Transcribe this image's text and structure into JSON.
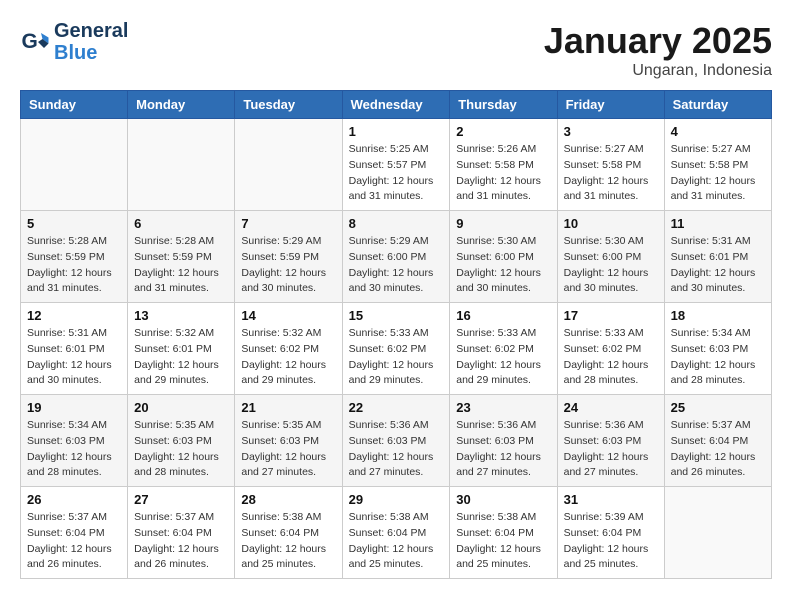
{
  "logo": {
    "line1": "General",
    "line2": "Blue"
  },
  "title": "January 2025",
  "subtitle": "Ungaran, Indonesia",
  "days_header": [
    "Sunday",
    "Monday",
    "Tuesday",
    "Wednesday",
    "Thursday",
    "Friday",
    "Saturday"
  ],
  "weeks": [
    [
      {
        "day": "",
        "info": ""
      },
      {
        "day": "",
        "info": ""
      },
      {
        "day": "",
        "info": ""
      },
      {
        "day": "1",
        "info": "Sunrise: 5:25 AM\nSunset: 5:57 PM\nDaylight: 12 hours\nand 31 minutes."
      },
      {
        "day": "2",
        "info": "Sunrise: 5:26 AM\nSunset: 5:58 PM\nDaylight: 12 hours\nand 31 minutes."
      },
      {
        "day": "3",
        "info": "Sunrise: 5:27 AM\nSunset: 5:58 PM\nDaylight: 12 hours\nand 31 minutes."
      },
      {
        "day": "4",
        "info": "Sunrise: 5:27 AM\nSunset: 5:58 PM\nDaylight: 12 hours\nand 31 minutes."
      }
    ],
    [
      {
        "day": "5",
        "info": "Sunrise: 5:28 AM\nSunset: 5:59 PM\nDaylight: 12 hours\nand 31 minutes."
      },
      {
        "day": "6",
        "info": "Sunrise: 5:28 AM\nSunset: 5:59 PM\nDaylight: 12 hours\nand 31 minutes."
      },
      {
        "day": "7",
        "info": "Sunrise: 5:29 AM\nSunset: 5:59 PM\nDaylight: 12 hours\nand 30 minutes."
      },
      {
        "day": "8",
        "info": "Sunrise: 5:29 AM\nSunset: 6:00 PM\nDaylight: 12 hours\nand 30 minutes."
      },
      {
        "day": "9",
        "info": "Sunrise: 5:30 AM\nSunset: 6:00 PM\nDaylight: 12 hours\nand 30 minutes."
      },
      {
        "day": "10",
        "info": "Sunrise: 5:30 AM\nSunset: 6:00 PM\nDaylight: 12 hours\nand 30 minutes."
      },
      {
        "day": "11",
        "info": "Sunrise: 5:31 AM\nSunset: 6:01 PM\nDaylight: 12 hours\nand 30 minutes."
      }
    ],
    [
      {
        "day": "12",
        "info": "Sunrise: 5:31 AM\nSunset: 6:01 PM\nDaylight: 12 hours\nand 30 minutes."
      },
      {
        "day": "13",
        "info": "Sunrise: 5:32 AM\nSunset: 6:01 PM\nDaylight: 12 hours\nand 29 minutes."
      },
      {
        "day": "14",
        "info": "Sunrise: 5:32 AM\nSunset: 6:02 PM\nDaylight: 12 hours\nand 29 minutes."
      },
      {
        "day": "15",
        "info": "Sunrise: 5:33 AM\nSunset: 6:02 PM\nDaylight: 12 hours\nand 29 minutes."
      },
      {
        "day": "16",
        "info": "Sunrise: 5:33 AM\nSunset: 6:02 PM\nDaylight: 12 hours\nand 29 minutes."
      },
      {
        "day": "17",
        "info": "Sunrise: 5:33 AM\nSunset: 6:02 PM\nDaylight: 12 hours\nand 28 minutes."
      },
      {
        "day": "18",
        "info": "Sunrise: 5:34 AM\nSunset: 6:03 PM\nDaylight: 12 hours\nand 28 minutes."
      }
    ],
    [
      {
        "day": "19",
        "info": "Sunrise: 5:34 AM\nSunset: 6:03 PM\nDaylight: 12 hours\nand 28 minutes."
      },
      {
        "day": "20",
        "info": "Sunrise: 5:35 AM\nSunset: 6:03 PM\nDaylight: 12 hours\nand 28 minutes."
      },
      {
        "day": "21",
        "info": "Sunrise: 5:35 AM\nSunset: 6:03 PM\nDaylight: 12 hours\nand 27 minutes."
      },
      {
        "day": "22",
        "info": "Sunrise: 5:36 AM\nSunset: 6:03 PM\nDaylight: 12 hours\nand 27 minutes."
      },
      {
        "day": "23",
        "info": "Sunrise: 5:36 AM\nSunset: 6:03 PM\nDaylight: 12 hours\nand 27 minutes."
      },
      {
        "day": "24",
        "info": "Sunrise: 5:36 AM\nSunset: 6:03 PM\nDaylight: 12 hours\nand 27 minutes."
      },
      {
        "day": "25",
        "info": "Sunrise: 5:37 AM\nSunset: 6:04 PM\nDaylight: 12 hours\nand 26 minutes."
      }
    ],
    [
      {
        "day": "26",
        "info": "Sunrise: 5:37 AM\nSunset: 6:04 PM\nDaylight: 12 hours\nand 26 minutes."
      },
      {
        "day": "27",
        "info": "Sunrise: 5:37 AM\nSunset: 6:04 PM\nDaylight: 12 hours\nand 26 minutes."
      },
      {
        "day": "28",
        "info": "Sunrise: 5:38 AM\nSunset: 6:04 PM\nDaylight: 12 hours\nand 25 minutes."
      },
      {
        "day": "29",
        "info": "Sunrise: 5:38 AM\nSunset: 6:04 PM\nDaylight: 12 hours\nand 25 minutes."
      },
      {
        "day": "30",
        "info": "Sunrise: 5:38 AM\nSunset: 6:04 PM\nDaylight: 12 hours\nand 25 minutes."
      },
      {
        "day": "31",
        "info": "Sunrise: 5:39 AM\nSunset: 6:04 PM\nDaylight: 12 hours\nand 25 minutes."
      },
      {
        "day": "",
        "info": ""
      }
    ]
  ]
}
